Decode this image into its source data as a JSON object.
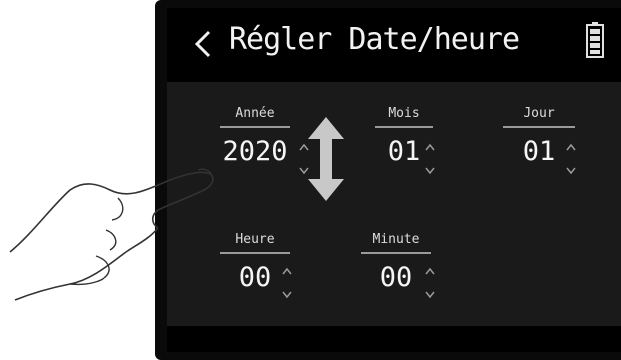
{
  "header": {
    "title": "Régler Date/heure",
    "back_icon": "chevron-left-icon",
    "battery_icon": "battery-icon"
  },
  "fields": {
    "year": {
      "label": "Année",
      "value": "2020"
    },
    "month": {
      "label": "Mois",
      "value": "01"
    },
    "day": {
      "label": "Jour",
      "value": "01"
    },
    "hour": {
      "label": "Heure",
      "value": "00"
    },
    "minute": {
      "label": "Minute",
      "value": "00"
    }
  },
  "overlay": {
    "gesture_icon": "swipe-up-down-arrow-icon",
    "hand_icon": "pointing-hand-icon"
  },
  "colors": {
    "screen_bg": "#1a1a1a",
    "titlebar_bg": "#000000",
    "arrow": "#c8c8c8"
  }
}
